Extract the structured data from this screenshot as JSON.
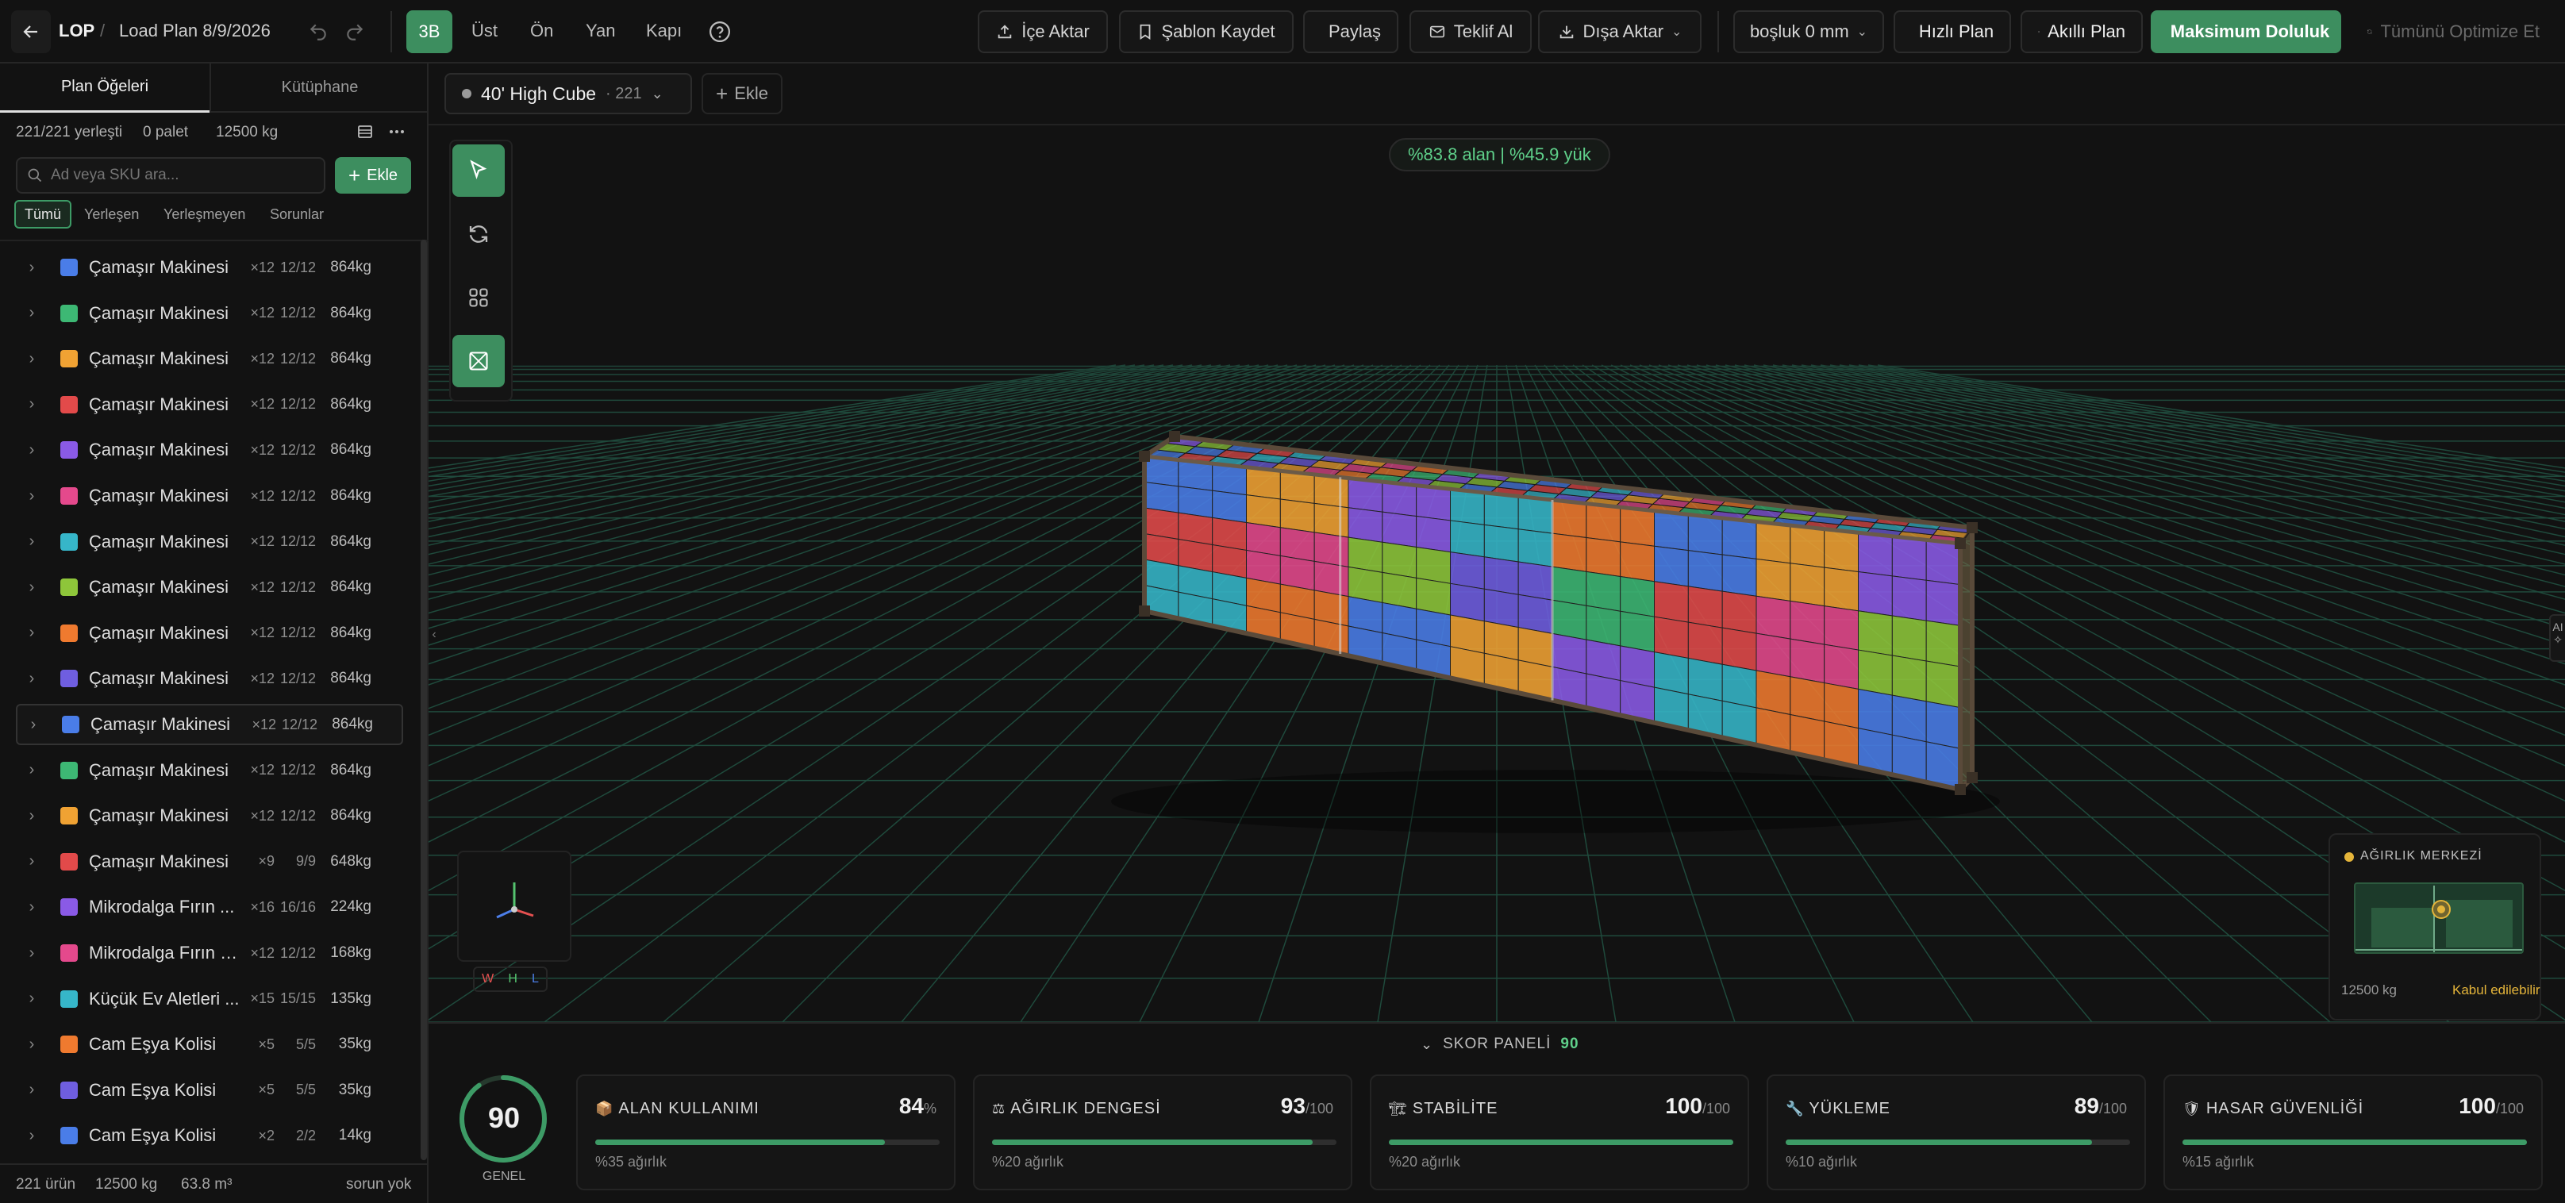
{
  "header": {
    "app": "LOP",
    "sep": "/",
    "plan": "Load Plan 8/9/2026"
  },
  "views": {
    "v3d": "3B",
    "top": "Üst",
    "front": "Ön",
    "side": "Yan",
    "door": "Kapı"
  },
  "actions": {
    "import": "İçe Aktar",
    "save_tpl": "Şablon Kaydet",
    "share": "Paylaş",
    "quote": "Teklif Al",
    "export": "Dışa Aktar",
    "gap": "boşluk 0 mm",
    "quick": "Hızlı Plan",
    "smart": "Akıllı Plan",
    "max": "Maksimum Doluluk",
    "optimize": "Tümünü Optimize Et"
  },
  "sidebar": {
    "tab_plan": "Plan Öğeleri",
    "tab_lib": "Kütüphane",
    "stats": {
      "placed": "221/221 yerleşti",
      "pallets": "0 palet",
      "weight": "12500 kg"
    },
    "search_ph": "Ad veya SKU ara...",
    "add": "Ekle",
    "filters": [
      "Tümü",
      "Yerleşen",
      "Yerleşmeyen",
      "Sorunlar"
    ],
    "items": [
      {
        "name": "Çamaşır Makinesi",
        "qty": "×12",
        "placed": "12/12",
        "weight": "864kg",
        "color": "#4a7de8"
      },
      {
        "name": "Çamaşır Makinesi",
        "qty": "×12",
        "placed": "12/12",
        "weight": "864kg",
        "color": "#3db874"
      },
      {
        "name": "Çamaşır Makinesi",
        "qty": "×12",
        "placed": "12/12",
        "weight": "864kg",
        "color": "#f0a233"
      },
      {
        "name": "Çamaşır Makinesi",
        "qty": "×12",
        "placed": "12/12",
        "weight": "864kg",
        "color": "#e24a4a"
      },
      {
        "name": "Çamaşır Makinesi",
        "qty": "×12",
        "placed": "12/12",
        "weight": "864kg",
        "color": "#8a5ae6"
      },
      {
        "name": "Çamaşır Makinesi",
        "qty": "×12",
        "placed": "12/12",
        "weight": "864kg",
        "color": "#e4498c"
      },
      {
        "name": "Çamaşır Makinesi",
        "qty": "×12",
        "placed": "12/12",
        "weight": "864kg",
        "color": "#36b6c9"
      },
      {
        "name": "Çamaşır Makinesi",
        "qty": "×12",
        "placed": "12/12",
        "weight": "864kg",
        "color": "#8ec63a"
      },
      {
        "name": "Çamaşır Makinesi",
        "qty": "×12",
        "placed": "12/12",
        "weight": "864kg",
        "color": "#ef7a2f"
      },
      {
        "name": "Çamaşır Makinesi",
        "qty": "×12",
        "placed": "12/12",
        "weight": "864kg",
        "color": "#6f5ee0"
      },
      {
        "name": "Çamaşır Makinesi",
        "qty": "×12",
        "placed": "12/12",
        "weight": "864kg",
        "color": "#4a7de8"
      },
      {
        "name": "Çamaşır Makinesi",
        "qty": "×12",
        "placed": "12/12",
        "weight": "864kg",
        "color": "#3db874"
      },
      {
        "name": "Çamaşır Makinesi",
        "qty": "×12",
        "placed": "12/12",
        "weight": "864kg",
        "color": "#f0a233"
      },
      {
        "name": "Çamaşır Makinesi",
        "qty": "×9",
        "placed": "9/9",
        "weight": "648kg",
        "color": "#e24a4a"
      },
      {
        "name": "Mikrodalga Fırın ...",
        "qty": "×16",
        "placed": "16/16",
        "weight": "224kg",
        "color": "#8a5ae6"
      },
      {
        "name": "Mikrodalga Fırın K...",
        "qty": "×12",
        "placed": "12/12",
        "weight": "168kg",
        "color": "#e4498c"
      },
      {
        "name": "Küçük Ev Aletleri ...",
        "qty": "×15",
        "placed": "15/15",
        "weight": "135kg",
        "color": "#36b6c9"
      },
      {
        "name": "Cam Eşya Kolisi",
        "qty": "×5",
        "placed": "5/5",
        "weight": "35kg",
        "color": "#ef7a2f"
      },
      {
        "name": "Cam Eşya Kolisi",
        "qty": "×5",
        "placed": "5/5",
        "weight": "35kg",
        "color": "#6f5ee0"
      },
      {
        "name": "Cam Eşya Kolisi",
        "qty": "×2",
        "placed": "2/2",
        "weight": "14kg",
        "color": "#4a7de8"
      }
    ],
    "footer": {
      "count": "221 ürün",
      "weight": "12500 kg",
      "volume": "63.8 m³",
      "issues": "sorun yok"
    }
  },
  "container": {
    "name": "40' High Cube",
    "count": "· 221",
    "add": "Ekle"
  },
  "fill_badge": "%83.8 alan | %45.9 yük",
  "axes": {
    "w": "W",
    "h": "H",
    "l": "L"
  },
  "cog": {
    "title": "AĞIRLIK MERKEZİ",
    "weight": "12500 kg",
    "status": "Kabul edilebilir"
  },
  "ai_label": "AI",
  "score": {
    "label": "SKOR PANELİ",
    "value": "90",
    "overall": "GENEL",
    "ring_fraction": 0.9,
    "cards": [
      {
        "title": "ALAN KULLANIMI",
        "value": "84",
        "unit": "%",
        "sub": "%35 ağırlık",
        "fill": 0.84
      },
      {
        "title": "AĞIRLIK DENGESİ",
        "value": "93",
        "unit": "/100",
        "sub": "%20 ağırlık",
        "fill": 0.93
      },
      {
        "title": "STABİLİTE",
        "value": "100",
        "unit": "/100",
        "sub": "%20 ağırlık",
        "fill": 1.0
      },
      {
        "title": "YÜKLEME",
        "value": "89",
        "unit": "/100",
        "sub": "%10 ağırlık",
        "fill": 0.89
      },
      {
        "title": "HASAR GÜVENLİĞİ",
        "value": "100",
        "unit": "/100",
        "sub": "%15 ağırlık",
        "fill": 1.0
      }
    ]
  }
}
